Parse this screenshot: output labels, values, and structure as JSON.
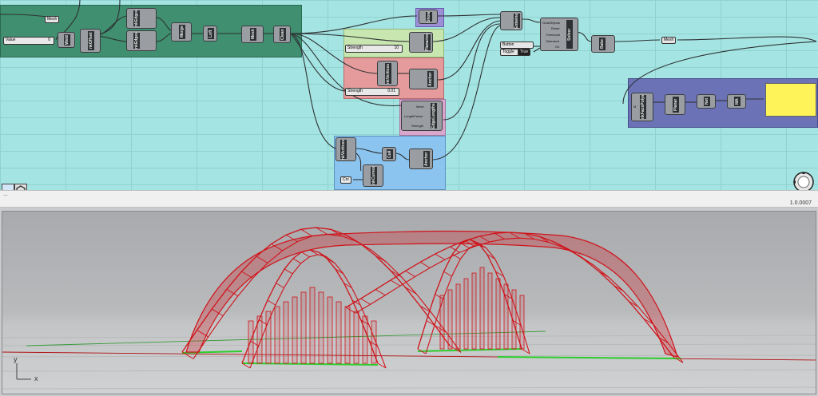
{
  "canvas": {
    "groups": [
      {
        "id": "g1",
        "color": "#3f8f70"
      },
      {
        "id": "g2",
        "color": "#c8e6b0"
      },
      {
        "id": "g3",
        "color": "#e59b9b"
      },
      {
        "id": "g4",
        "color": "#d9a6cc"
      },
      {
        "id": "g5",
        "color": "#8cc4f0"
      },
      {
        "id": "g6",
        "color": "#6b73b6"
      },
      {
        "id": "g7",
        "color": "#9c8fd6"
      }
    ],
    "components": {
      "weld": "Weld",
      "naked_edges_top": "nkEdges",
      "naked_edges_bottom": "nkEdges",
      "offset": "nkOffset",
      "merge": "Merge",
      "loft": "Loft",
      "mesh": "Mesh",
      "clean": "Clean",
      "show": "Show",
      "planarize": "Planarize",
      "nkvertices": "nkVertices",
      "anchor1": "Anchor",
      "edge_lengths": "EdgeLengths",
      "nkvertices2": "nkVertices",
      "cull": "Cull",
      "anchor2": "Anchor",
      "nkcurves": "nkCurves",
      "entwine": "Entwine",
      "solver": "Solver",
      "bake": "Bake",
      "facepolys": "nkFacePolys",
      "planar_srf": "Planar",
      "net": "Net",
      "mA": "MA"
    },
    "solver_ports": [
      "GoalObjects",
      "Reset",
      "Threshold",
      "Tolerance",
      "On"
    ],
    "edge_ports": [
      "Mesh",
      "LengthFactor",
      "Strength"
    ],
    "anchor_ports": [
      "P",
      "Pt",
      "Strength"
    ],
    "mesh_tag": "Mesh",
    "mesh_tag2": "Mesh",
    "crv_tag": "Crv",
    "value_slider": {
      "label": "Value",
      "value": "0"
    },
    "strength_slider_1": {
      "label": "Strength",
      "value": "10"
    },
    "strength_slider_2": {
      "label": "Strength",
      "value": "0.01"
    },
    "button_label": "Button",
    "toggle_label": "Toggle",
    "toggle_value": "True",
    "ports_in": [
      "M"
    ]
  },
  "status": {
    "left": "...",
    "version": "1.0.0007"
  },
  "viewport": {
    "axis_labels": {
      "x": "x",
      "y": "y"
    },
    "mesh_color": "#d0131a",
    "ground_color": "#2ecc2e"
  }
}
